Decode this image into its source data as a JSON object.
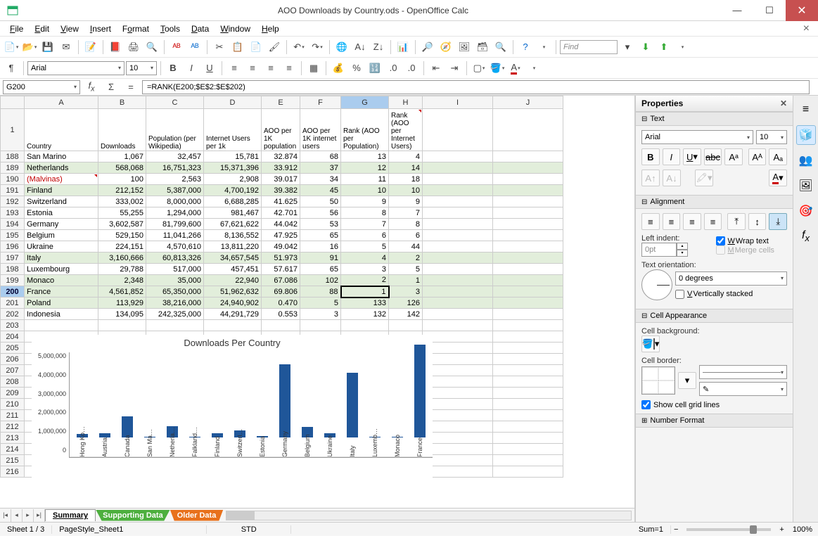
{
  "window": {
    "title": "AOO Downloads by Country.ods - OpenOffice Calc"
  },
  "menus": [
    "File",
    "Edit",
    "View",
    "Insert",
    "Format",
    "Tools",
    "Data",
    "Window",
    "Help"
  ],
  "find_placeholder": "Find",
  "formatting": {
    "font_name": "Arial",
    "font_size": "10"
  },
  "cellref": {
    "ref": "G200",
    "formula": "=RANK(E200;$E$2:$E$202)"
  },
  "columns": [
    "A",
    "B",
    "C",
    "D",
    "E",
    "F",
    "G",
    "H",
    "I",
    "J"
  ],
  "headers": {
    "A": "Country",
    "B": "Downloads",
    "C": "Population (per Wikipedia)",
    "D": "Internet Users per 1k",
    "E": "AOO per 1K population",
    "F": "AOO per 1K internet users",
    "G": "Rank (AOO per Population)",
    "H": "Rank (AOO per Internet Users)"
  },
  "rows": [
    {
      "n": 188,
      "even": false,
      "c": [
        "San Marino",
        "1,067",
        "32,457",
        "15,781",
        "32.874",
        "68",
        "13",
        "4"
      ]
    },
    {
      "n": 189,
      "even": true,
      "c": [
        "Netherlands",
        "568,068",
        "16,751,323",
        "15,371,396",
        "33.912",
        "37",
        "12",
        "14"
      ]
    },
    {
      "n": 190,
      "even": false,
      "malvinas": true,
      "c": [
        "(Malvinas)",
        "100",
        "2,563",
        "2,908",
        "39.017",
        "34",
        "11",
        "18"
      ]
    },
    {
      "n": 191,
      "even": true,
      "c": [
        "Finland",
        "212,152",
        "5,387,000",
        "4,700,192",
        "39.382",
        "45",
        "10",
        "10"
      ]
    },
    {
      "n": 192,
      "even": false,
      "c": [
        "Switzerland",
        "333,002",
        "8,000,000",
        "6,688,285",
        "41.625",
        "50",
        "9",
        "9"
      ]
    },
    {
      "n": 193,
      "even": false,
      "c": [
        "Estonia",
        "55,255",
        "1,294,000",
        "981,467",
        "42.701",
        "56",
        "8",
        "7"
      ]
    },
    {
      "n": 194,
      "even": false,
      "c": [
        "Germany",
        "3,602,587",
        "81,799,600",
        "67,621,622",
        "44.042",
        "53",
        "7",
        "8"
      ]
    },
    {
      "n": 195,
      "even": false,
      "c": [
        "Belgium",
        "529,150",
        "11,041,266",
        "8,136,552",
        "47.925",
        "65",
        "6",
        "6"
      ]
    },
    {
      "n": 196,
      "even": false,
      "c": [
        "Ukraine",
        "224,151",
        "4,570,610",
        "13,811,220",
        "49.042",
        "16",
        "5",
        "44"
      ]
    },
    {
      "n": 197,
      "even": true,
      "c": [
        "Italy",
        "3,160,666",
        "60,813,326",
        "34,657,545",
        "51.973",
        "91",
        "4",
        "2"
      ]
    },
    {
      "n": 198,
      "even": false,
      "c": [
        "Luxembourg",
        "29,788",
        "517,000",
        "457,451",
        "57.617",
        "65",
        "3",
        "5"
      ]
    },
    {
      "n": 199,
      "even": true,
      "c": [
        "Monaco",
        "2,348",
        "35,000",
        "22,940",
        "67.086",
        "102",
        "2",
        "1"
      ]
    },
    {
      "n": 200,
      "even": true,
      "sel": true,
      "c": [
        "France",
        "4,561,852",
        "65,350,000",
        "51,962,632",
        "69.806",
        "88",
        "1",
        "3"
      ]
    },
    {
      "n": 201,
      "even": true,
      "c": [
        "Poland",
        "113,929",
        "38,216,000",
        "24,940,902",
        "0.470",
        "5",
        "133",
        "126"
      ]
    },
    {
      "n": 202,
      "even": false,
      "c": [
        "Indonesia",
        "134,095",
        "242,325,000",
        "44,291,729",
        "0.553",
        "3",
        "132",
        "142"
      ]
    }
  ],
  "empty_rows": [
    203,
    204,
    205,
    206,
    207,
    208,
    209,
    210,
    211,
    212,
    213,
    214,
    215,
    216
  ],
  "sheet_tabs": {
    "active": "Summary",
    "supporting": "Supporting Data",
    "older": "Older Data"
  },
  "status": {
    "sheet": "Sheet 1 / 3",
    "style": "PageStyle_Sheet1",
    "mode": "STD",
    "sum": "Sum=1",
    "zoom": "100%"
  },
  "sidebar": {
    "title": "Properties",
    "text": {
      "title": "Text",
      "font": "Arial",
      "size": "10"
    },
    "alignment": {
      "title": "Alignment",
      "indent_label": "Left indent:",
      "indent_val": "0pt",
      "wrap": "Wrap text",
      "merge": "Merge cells"
    },
    "orientation": {
      "label": "Text orientation:",
      "deg": "0 degrees",
      "stacked": "Vertically stacked"
    },
    "appearance": {
      "title": "Cell Appearance",
      "bg": "Cell background:",
      "border": "Cell border:",
      "grid": "Show cell grid lines"
    },
    "numfmt": {
      "title": "Number Format"
    }
  },
  "chart_data": {
    "type": "bar",
    "title": "Downloads Per Country",
    "ylabel": "",
    "ylim": [
      0,
      5000000
    ],
    "yticks": [
      "5,000,000",
      "4,000,000",
      "3,000,000",
      "2,000,000",
      "1,000,000",
      "0"
    ],
    "categories": [
      "Hong Ko…",
      "Austria",
      "Canada",
      "San Ma…",
      "Netherla…",
      "Falkland…",
      "Finland",
      "Switzerl…",
      "Estonia",
      "Germany",
      "Belgium",
      "Ukraine",
      "Italy",
      "Luxemb…",
      "Monaco",
      "France"
    ],
    "values": [
      180000,
      200000,
      1030000,
      1067,
      568068,
      100,
      212152,
      333002,
      55255,
      3602587,
      529150,
      224151,
      3160666,
      29788,
      2348,
      4561852
    ]
  }
}
